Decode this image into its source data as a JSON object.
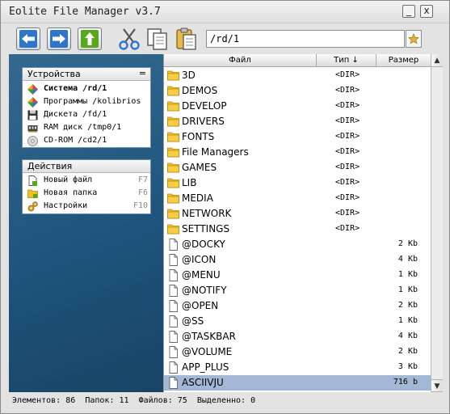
{
  "window": {
    "title": "Eolite File Manager v3.7",
    "minimize_label": "_",
    "close_label": "x"
  },
  "toolbar": {
    "buttons": [
      "back-icon",
      "forward-icon",
      "up-icon",
      "cut-icon",
      "copy-icon",
      "paste-icon"
    ],
    "path_value": "/rd/1",
    "favorite_icon": "star-icon"
  },
  "devices": {
    "title": "Устройства",
    "toggle": "=",
    "items": [
      {
        "label": "Система /rd/1",
        "icon": "system-icon",
        "bold": true
      },
      {
        "label": "Программы /kolibrios",
        "icon": "programs-icon"
      },
      {
        "label": "Дискета /fd/1",
        "icon": "floppy-icon"
      },
      {
        "label": "RAM диск /tmp0/1",
        "icon": "ram-disk-icon"
      },
      {
        "label": "CD-ROM /cd2/1",
        "icon": "cdrom-icon"
      }
    ]
  },
  "actions": {
    "title": "Действия",
    "items": [
      {
        "label": "Новый файл",
        "hotkey": "F7",
        "icon": "new-file-icon"
      },
      {
        "label": "Новая папка",
        "hotkey": "F6",
        "icon": "new-folder-icon"
      },
      {
        "label": "Настройки",
        "hotkey": "F10",
        "icon": "settings-icon"
      }
    ]
  },
  "columns": {
    "name": "Файл",
    "type": "Тип",
    "sort_indicator": "↓",
    "size": "Размер"
  },
  "files": [
    {
      "name": "3D",
      "type": "<DIR>",
      "size": "",
      "kind": "folder"
    },
    {
      "name": "DEMOS",
      "type": "<DIR>",
      "size": "",
      "kind": "folder"
    },
    {
      "name": "DEVELOP",
      "type": "<DIR>",
      "size": "",
      "kind": "folder"
    },
    {
      "name": "DRIVERS",
      "type": "<DIR>",
      "size": "",
      "kind": "folder"
    },
    {
      "name": "FONTS",
      "type": "<DIR>",
      "size": "",
      "kind": "folder"
    },
    {
      "name": "File Managers",
      "type": "<DIR>",
      "size": "",
      "kind": "folder"
    },
    {
      "name": "GAMES",
      "type": "<DIR>",
      "size": "",
      "kind": "folder"
    },
    {
      "name": "LIB",
      "type": "<DIR>",
      "size": "",
      "kind": "folder"
    },
    {
      "name": "MEDIA",
      "type": "<DIR>",
      "size": "",
      "kind": "folder"
    },
    {
      "name": "NETWORK",
      "type": "<DIR>",
      "size": "",
      "kind": "folder"
    },
    {
      "name": "SETTINGS",
      "type": "<DIR>",
      "size": "",
      "kind": "folder"
    },
    {
      "name": "@DOCKY",
      "type": "",
      "size": "2 Kb",
      "kind": "file"
    },
    {
      "name": "@ICON",
      "type": "",
      "size": "4 Kb",
      "kind": "file"
    },
    {
      "name": "@MENU",
      "type": "",
      "size": "1 Kb",
      "kind": "file"
    },
    {
      "name": "@NOTIFY",
      "type": "",
      "size": "1 Kb",
      "kind": "file"
    },
    {
      "name": "@OPEN",
      "type": "",
      "size": "2 Kb",
      "kind": "file"
    },
    {
      "name": "@SS",
      "type": "",
      "size": "1 Kb",
      "kind": "file"
    },
    {
      "name": "@TASKBAR",
      "type": "",
      "size": "4 Kb",
      "kind": "file"
    },
    {
      "name": "@VOLUME",
      "type": "",
      "size": "2 Kb",
      "kind": "file"
    },
    {
      "name": "APP_PLUS",
      "type": "",
      "size": "3 Kb",
      "kind": "file"
    },
    {
      "name": "ASCIIVJU",
      "type": "",
      "size": "716 b",
      "kind": "file",
      "selected": true
    }
  ],
  "scrollbar": {
    "up_label": "▲",
    "down_label": "▼"
  },
  "status": {
    "elements_label": "Элементов:",
    "elements": "86",
    "folders_label": "Папок:",
    "folders": "11",
    "files_label": "Файлов:",
    "files": "75",
    "selected_label": "Выделенно:",
    "selected": "0"
  },
  "colors": {
    "left_pane": "#1f547c",
    "selection": "#a2b8d4",
    "folder": "#f4c021",
    "button_blue": "#2f76c8",
    "button_green": "#58a81b"
  }
}
